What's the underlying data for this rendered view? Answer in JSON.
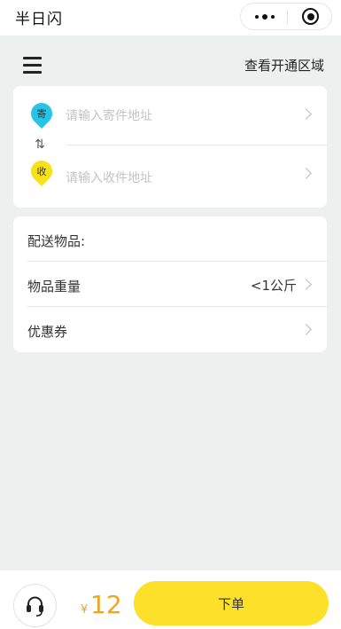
{
  "titlebar": {
    "app_title": "半日闪"
  },
  "header": {
    "region_link": "查看开通区域"
  },
  "address": {
    "sender_badge": "寄",
    "sender_placeholder": "请输入寄件地址",
    "receiver_badge": "收",
    "receiver_placeholder": "请输入收件地址",
    "swap_symbol": "⇅"
  },
  "goods": {
    "items_label": "配送物品:",
    "weight_label": "物品重量",
    "weight_value": "<1公斤",
    "coupon_label": "优惠券"
  },
  "footer": {
    "currency": "¥",
    "price": "12",
    "order_label": "下单"
  },
  "colors": {
    "accent_yellow": "#fde02a",
    "price_orange": "#f2a51c",
    "sender_blue": "#27c4e8",
    "receiver_yellow": "#f7e118",
    "background": "#eef0f0"
  },
  "icons": {
    "menu": "menu-icon",
    "more": "more-dots-icon",
    "close": "target-close-icon",
    "swap": "swap-icon",
    "chevron": "chevron-right-icon",
    "service": "headset-icon"
  }
}
